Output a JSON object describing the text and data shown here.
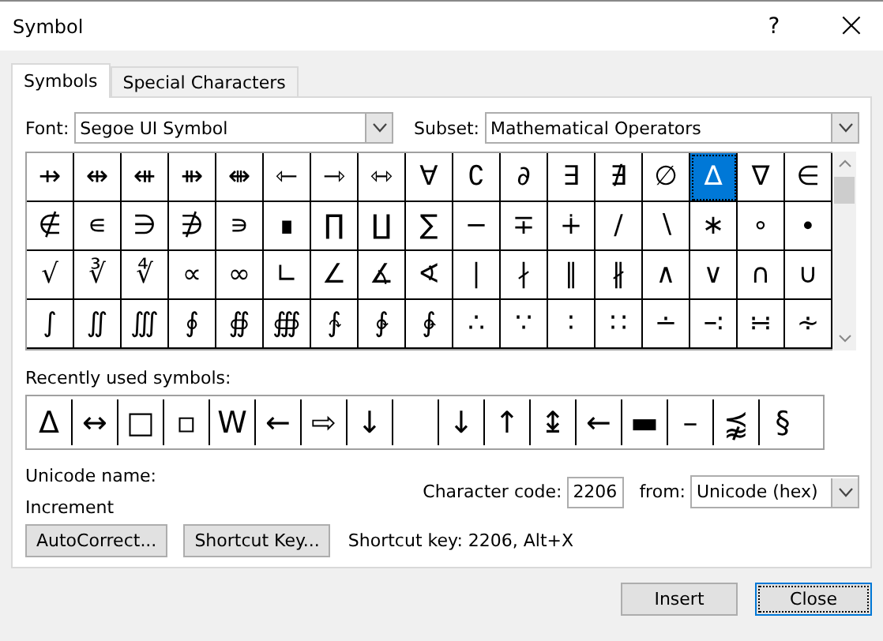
{
  "window": {
    "title": "Symbol",
    "help": "?",
    "close": "×"
  },
  "tabs": [
    {
      "label": "Symbols",
      "selected": true
    },
    {
      "label": "Special Characters",
      "selected": false
    }
  ],
  "font": {
    "label": "Font:",
    "value": "Segoe UI Symbol"
  },
  "subset": {
    "label": "Subset:",
    "value": "Mathematical Operators"
  },
  "symbols": [
    {
      "symbol": "⇸",
      "selected": false
    },
    {
      "symbol": "⇹",
      "selected": false
    },
    {
      "symbol": "⇺",
      "selected": false
    },
    {
      "symbol": "⇻",
      "selected": false
    },
    {
      "symbol": "⇼",
      "selected": false
    },
    {
      "symbol": "⇽",
      "selected": false
    },
    {
      "symbol": "⇾",
      "selected": false
    },
    {
      "symbol": "⇿",
      "selected": false
    },
    {
      "symbol": "∀",
      "selected": false
    },
    {
      "symbol": "∁",
      "selected": false
    },
    {
      "symbol": "∂",
      "selected": false
    },
    {
      "symbol": "∃",
      "selected": false
    },
    {
      "symbol": "∄",
      "selected": false
    },
    {
      "symbol": "∅",
      "selected": false
    },
    {
      "symbol": "∆",
      "selected": true
    },
    {
      "symbol": "∇",
      "selected": false
    },
    {
      "symbol": "∈",
      "selected": false
    },
    {
      "symbol": "∉",
      "selected": false
    },
    {
      "symbol": "∊",
      "selected": false
    },
    {
      "symbol": "∋",
      "selected": false
    },
    {
      "symbol": "∌",
      "selected": false
    },
    {
      "symbol": "∍",
      "selected": false
    },
    {
      "symbol": "∎",
      "selected": false
    },
    {
      "symbol": "∏",
      "selected": false
    },
    {
      "symbol": "∐",
      "selected": false
    },
    {
      "symbol": "∑",
      "selected": false
    },
    {
      "symbol": "−",
      "selected": false
    },
    {
      "symbol": "∓",
      "selected": false
    },
    {
      "symbol": "∔",
      "selected": false
    },
    {
      "symbol": "∕",
      "selected": false
    },
    {
      "symbol": "∖",
      "selected": false
    },
    {
      "symbol": "∗",
      "selected": false
    },
    {
      "symbol": "∘",
      "selected": false
    },
    {
      "symbol": "∙",
      "selected": false
    },
    {
      "symbol": "√",
      "selected": false
    },
    {
      "symbol": "∛",
      "selected": false
    },
    {
      "symbol": "∜",
      "selected": false
    },
    {
      "symbol": "∝",
      "selected": false
    },
    {
      "symbol": "∞",
      "selected": false
    },
    {
      "symbol": "∟",
      "selected": false
    },
    {
      "symbol": "∠",
      "selected": false
    },
    {
      "symbol": "∡",
      "selected": false
    },
    {
      "symbol": "∢",
      "selected": false
    },
    {
      "symbol": "∣",
      "selected": false
    },
    {
      "symbol": "∤",
      "selected": false
    },
    {
      "symbol": "∥",
      "selected": false
    },
    {
      "symbol": "∦",
      "selected": false
    },
    {
      "symbol": "∧",
      "selected": false
    },
    {
      "symbol": "∨",
      "selected": false
    },
    {
      "symbol": "∩",
      "selected": false
    },
    {
      "symbol": "∪",
      "selected": false
    },
    {
      "symbol": "∫",
      "selected": false
    },
    {
      "symbol": "∬",
      "selected": false
    },
    {
      "symbol": "∭",
      "selected": false
    },
    {
      "symbol": "∮",
      "selected": false
    },
    {
      "symbol": "∯",
      "selected": false
    },
    {
      "symbol": "∰",
      "selected": false
    },
    {
      "symbol": "∱",
      "selected": false
    },
    {
      "symbol": "∲",
      "selected": false
    },
    {
      "symbol": "∳",
      "selected": false
    },
    {
      "symbol": "∴",
      "selected": false
    },
    {
      "symbol": "∵",
      "selected": false
    },
    {
      "symbol": "∶",
      "selected": false
    },
    {
      "symbol": "∷",
      "selected": false
    },
    {
      "symbol": "∸",
      "selected": false
    },
    {
      "symbol": "∹",
      "selected": false
    },
    {
      "symbol": "∺",
      "selected": false
    },
    {
      "symbol": "∻",
      "selected": false
    }
  ],
  "recent_label": "Recently used symbols:",
  "recent": [
    {
      "kind": "symbol",
      "symbol": "Δ"
    },
    {
      "kind": "symbol",
      "symbol": "↔"
    },
    {
      "kind": "symbol",
      "symbol": "□"
    },
    {
      "kind": "symbol",
      "symbol": "▫"
    },
    {
      "kind": "symbol",
      "symbol": "W"
    },
    {
      "kind": "symbol",
      "symbol": "←"
    },
    {
      "kind": "symbol",
      "symbol": "⇨"
    },
    {
      "kind": "symbol",
      "symbol": "↓"
    },
    {
      "kind": "blank"
    },
    {
      "kind": "symbol",
      "symbol": "↓"
    },
    {
      "kind": "symbol",
      "symbol": "↑"
    },
    {
      "kind": "symbol",
      "symbol": "↨"
    },
    {
      "kind": "symbol",
      "symbol": "←"
    },
    {
      "kind": "symbol",
      "symbol": "▬"
    },
    {
      "kind": "symbol",
      "symbol": "–"
    },
    {
      "kind": "symbol",
      "symbol": "⪹"
    },
    {
      "kind": "symbol",
      "symbol": "§"
    }
  ],
  "unicode_name": {
    "label": "Unicode name:",
    "value": "Increment"
  },
  "character_code": {
    "label": "Character code:",
    "value": "2206"
  },
  "from": {
    "label": "from:",
    "value": "Unicode (hex)"
  },
  "autocorrect_button": "AutoCorrect...",
  "shortcut_key_button": "Shortcut Key...",
  "shortcut_key": "Shortcut key: 2206, Alt+X",
  "buttons": [
    {
      "label": "Insert",
      "default": false
    },
    {
      "label": "Close",
      "default": true
    }
  ]
}
